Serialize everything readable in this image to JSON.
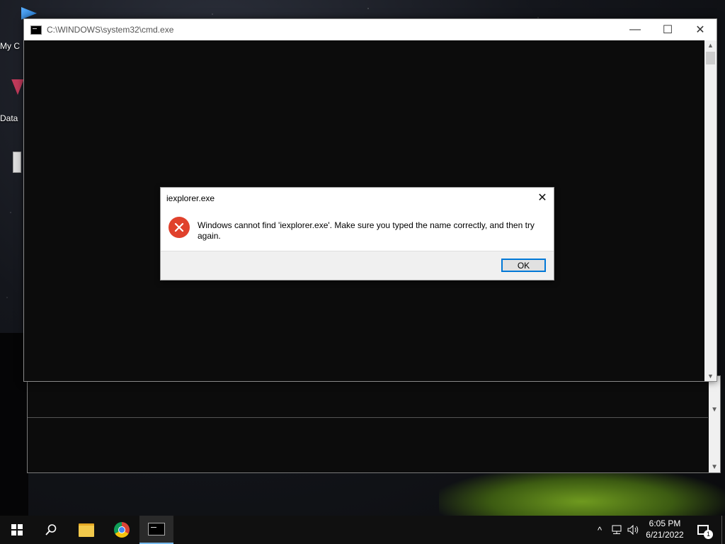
{
  "desktop": {
    "icons": [
      {
        "label": "My C",
        "icon": "computer-icon"
      },
      {
        "label": "Data",
        "icon": "shortcut-icon"
      }
    ]
  },
  "cmd_window": {
    "title": "C:\\WINDOWS\\system32\\cmd.exe",
    "icon": "console-icon",
    "controls": {
      "minimize": "—",
      "maximize": "☐",
      "close": "✕"
    }
  },
  "dialog": {
    "title": "iexplorer.exe",
    "message": "Windows cannot find 'iexplorer.exe'. Make sure you typed the name correctly, and then try again.",
    "ok_label": "OK",
    "icon": "error-icon",
    "close": "✕"
  },
  "taskbar": {
    "items": [
      {
        "name": "start",
        "icon": "windows-logo-icon"
      },
      {
        "name": "search",
        "icon": "search-icon"
      },
      {
        "name": "file-explorer",
        "icon": "folder-icon"
      },
      {
        "name": "chrome",
        "icon": "chrome-icon"
      },
      {
        "name": "command-prompt",
        "icon": "console-icon",
        "active": true
      }
    ],
    "tray": {
      "chevron": "^",
      "time": "6:05 PM",
      "date": "6/21/2022",
      "notification_count": "1"
    }
  },
  "colors": {
    "console_bg": "#0c0c0c",
    "error_red": "#e0412c",
    "focus_blue": "#0078d7",
    "taskbar_bg": "#101010"
  }
}
